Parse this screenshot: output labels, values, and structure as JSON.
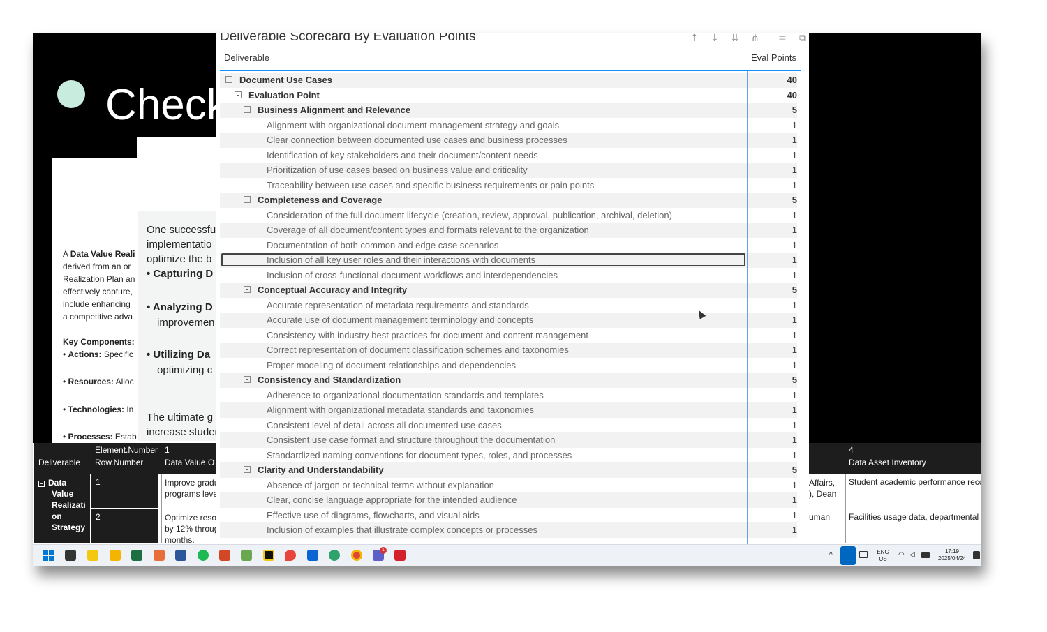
{
  "slide": {
    "title": "Check",
    "para_lines": [
      "One successful",
      "implementatio",
      "optimize the b"
    ],
    "bullets_main": [
      "Capturing D",
      "Analyzing D",
      "improvemen",
      "Utilizing Da",
      "optimizing c"
    ],
    "closing_lines": [
      "The ultimate g",
      "increase studer"
    ],
    "left_lines": [
      {
        "bold": "Data Value Reali",
        "pre": "A "
      },
      {
        "text": "derived from an or"
      },
      {
        "text": "Realization Plan an"
      },
      {
        "text": "effectively capture,"
      },
      {
        "text": "include enhancing"
      },
      {
        "text": "a competitive adva"
      }
    ],
    "key_components": "Key Components:",
    "components": [
      {
        "label": "Actions:",
        "rest": " Specific"
      },
      {
        "label": "Resources:",
        "rest": " Alloc"
      },
      {
        "label": "Technologies:",
        "rest": " In"
      },
      {
        "label": "Processes:",
        "rest": " Estab"
      }
    ]
  },
  "scorecard": {
    "title": "Deliverable Scorecard By Evaluation Points",
    "col_deliverable": "Deliverable",
    "col_eval_points": "Eval Points",
    "icons": [
      "arrow-up-icon",
      "arrow-down-icon",
      "expand-icon",
      "drill-icon",
      "filter-icon",
      "focus-icon"
    ],
    "rows": [
      {
        "level": 0,
        "label": "Document Use Cases",
        "value": "40"
      },
      {
        "level": 1,
        "label": "Evaluation Point",
        "value": "40"
      },
      {
        "level": 2,
        "label": "Business Alignment and Relevance",
        "value": "5"
      },
      {
        "level": 3,
        "label": "Alignment with organizational document management strategy and goals",
        "value": "1"
      },
      {
        "level": 3,
        "label": "Clear connection between documented use cases and business processes",
        "value": "1"
      },
      {
        "level": 3,
        "label": "Identification of key stakeholders and their document/content needs",
        "value": "1"
      },
      {
        "level": 3,
        "label": "Prioritization of use cases based on business value and criticality",
        "value": "1"
      },
      {
        "level": 3,
        "label": "Traceability between use cases and specific business requirements or pain points",
        "value": "1"
      },
      {
        "level": 2,
        "label": "Completeness and Coverage",
        "value": "5"
      },
      {
        "level": 3,
        "label": "Consideration of the full document lifecycle (creation, review, approval, publication, archival, deletion)",
        "value": "1"
      },
      {
        "level": 3,
        "label": "Coverage of all document/content types and formats relevant to the organization",
        "value": "1"
      },
      {
        "level": 3,
        "label": "Documentation of both common and edge case scenarios",
        "value": "1"
      },
      {
        "level": 3,
        "label": "Inclusion of all key user roles and their interactions with documents",
        "value": "1",
        "selected": true
      },
      {
        "level": 3,
        "label": "Inclusion of cross-functional document workflows and interdependencies",
        "value": "1"
      },
      {
        "level": 2,
        "label": "Conceptual Accuracy and Integrity",
        "value": "5"
      },
      {
        "level": 3,
        "label": "Accurate representation of metadata requirements and standards",
        "value": "1"
      },
      {
        "level": 3,
        "label": "Accurate use of document management terminology and concepts",
        "value": "1"
      },
      {
        "level": 3,
        "label": "Consistency with industry best practices for document and content management",
        "value": "1"
      },
      {
        "level": 3,
        "label": "Correct representation of document classification schemes and taxonomies",
        "value": "1"
      },
      {
        "level": 3,
        "label": "Proper modeling of document relationships and dependencies",
        "value": "1"
      },
      {
        "level": 2,
        "label": "Consistency and Standardization",
        "value": "5"
      },
      {
        "level": 3,
        "label": "Adherence to organizational documentation standards and templates",
        "value": "1"
      },
      {
        "level": 3,
        "label": "Alignment with organizational metadata standards and taxonomies",
        "value": "1"
      },
      {
        "level": 3,
        "label": "Consistent level of detail across all documented use cases",
        "value": "1"
      },
      {
        "level": 3,
        "label": "Consistent use case format and structure throughout the documentation",
        "value": "1"
      },
      {
        "level": 3,
        "label": "Standardized naming conventions for document types, roles, and processes",
        "value": "1"
      },
      {
        "level": 2,
        "label": "Clarity and Understandability",
        "value": "5"
      },
      {
        "level": 3,
        "label": "Absence of jargon or technical terms without explanation",
        "value": "1"
      },
      {
        "level": 3,
        "label": "Clear, concise language appropriate for the intended audience",
        "value": "1"
      },
      {
        "level": 3,
        "label": "Effective use of diagrams, flowcharts, and visual aids",
        "value": "1"
      },
      {
        "level": 3,
        "label": "Inclusion of examples that illustrate complex concepts or processes",
        "value": "1"
      }
    ]
  },
  "bottom_table": {
    "h_element_number": "Element.Number",
    "h_row_number": "Row.Number",
    "h_deliverable": "Deliverable",
    "h_col1": "1",
    "h_data_value_obj": "Data Value Ob",
    "h_col4": "4",
    "h_data_asset_inventory": "Data Asset Inventory",
    "deliverable_name": [
      "Data",
      "Value",
      "Realizati",
      "on",
      "Strategy"
    ],
    "row1_num": "1",
    "row2_num": "2",
    "row1_obj": [
      "Improve gradu",
      "programs leve"
    ],
    "row2_obj": [
      "Optimize resou",
      "by 12% throug",
      "months."
    ],
    "row1_right_a": [
      "Affairs,",
      "), Dean"
    ],
    "row2_right_a": "uman",
    "row1_right_b": "Student academic performance recor",
    "row2_right_b": "Facilities usage data, departmental b"
  },
  "taskbar": {
    "lang_top": "ENG",
    "lang_bottom": "US",
    "time": "17:19",
    "date": "2025/04/24",
    "notification_count": "1"
  }
}
